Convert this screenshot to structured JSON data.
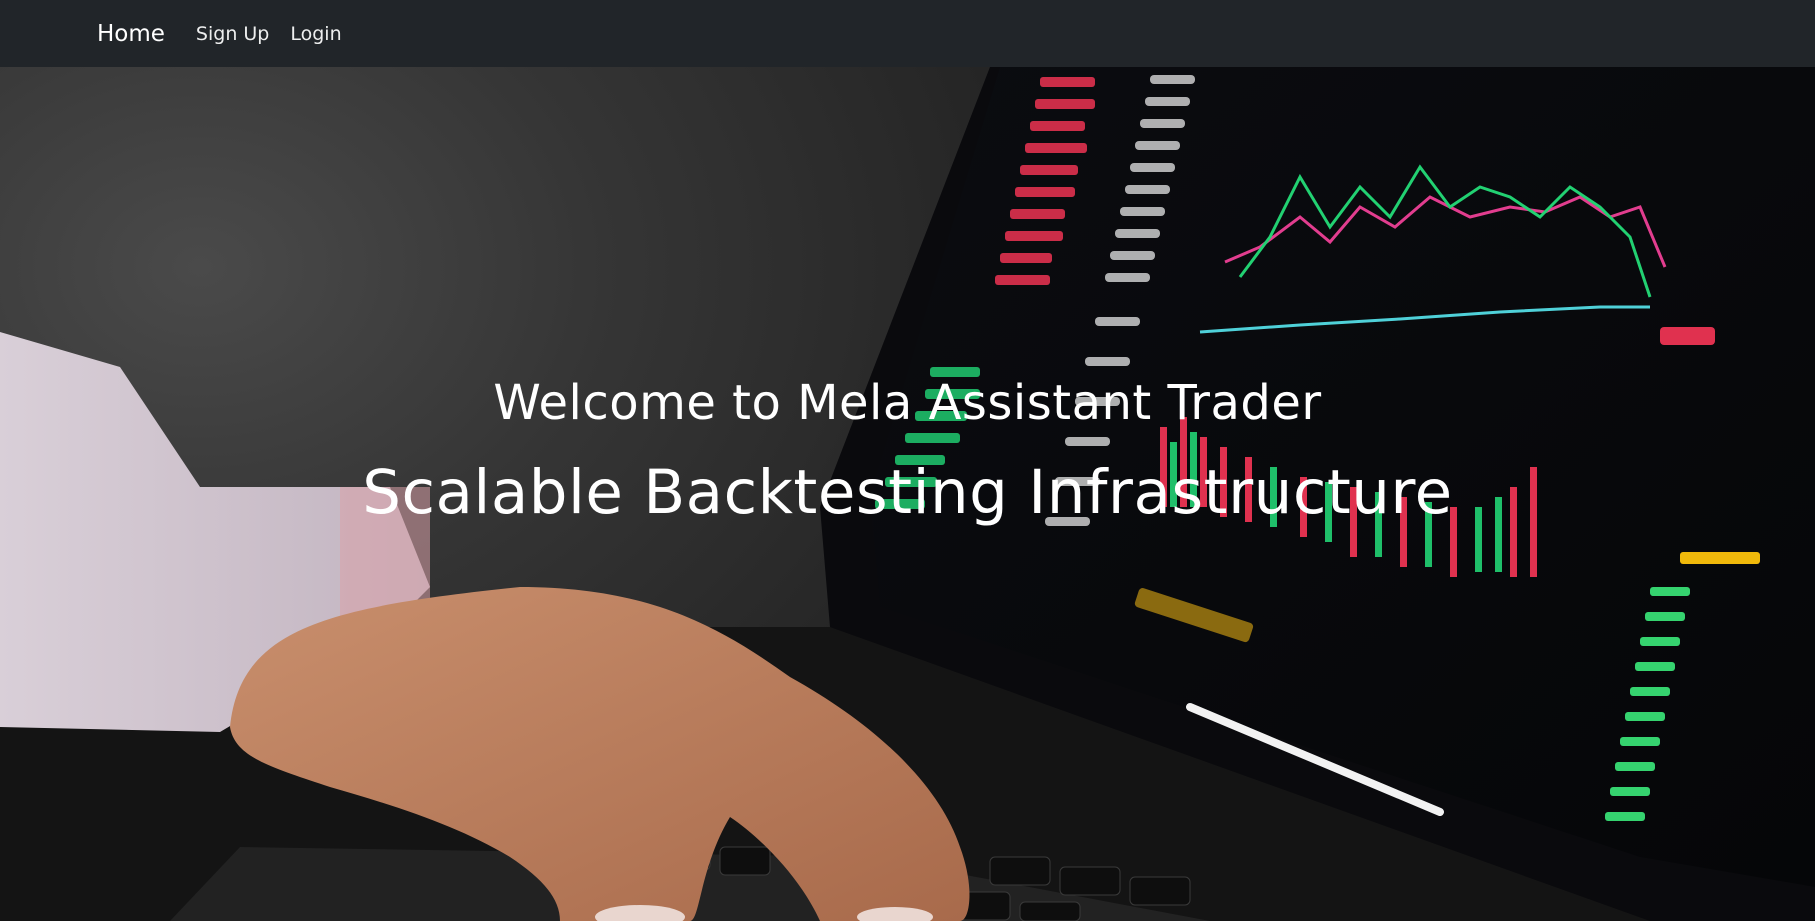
{
  "navbar": {
    "brand": "Home",
    "links": [
      {
        "label": "Sign Up"
      },
      {
        "label": "Login"
      }
    ],
    "background": "#212529"
  },
  "hero": {
    "title": "Welcome to Mela Assistant Trader",
    "subtitle": "Scalable Backtesting Infrastructure",
    "background_image": "laptop-trading-chart-photo"
  }
}
